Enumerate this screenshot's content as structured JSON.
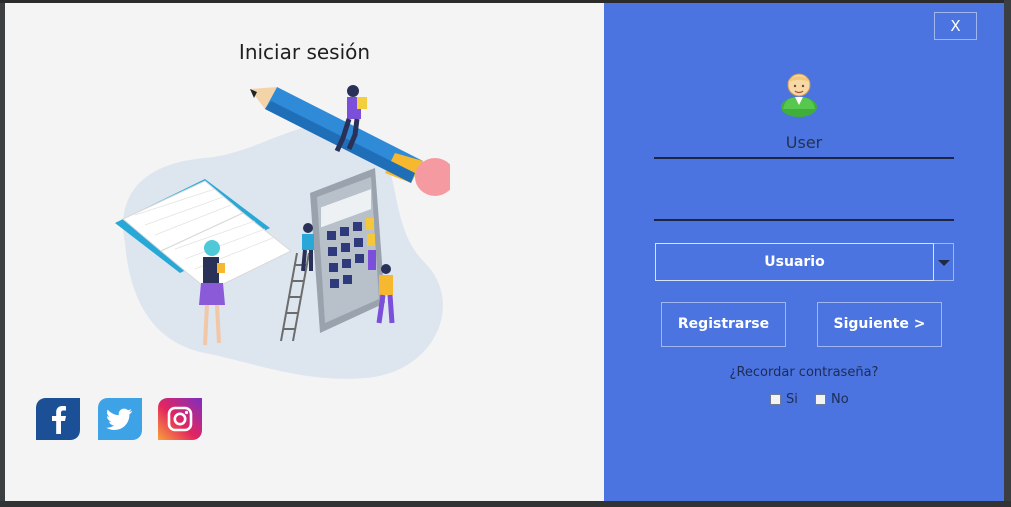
{
  "left": {
    "title": "Iniciar sesión",
    "social": [
      {
        "name": "facebook-icon",
        "color": "#1b4f96"
      },
      {
        "name": "twitter-icon",
        "color": "#3ea3e6"
      },
      {
        "name": "instagram-icon",
        "color": "#d6246e"
      }
    ]
  },
  "right": {
    "close_label": "X",
    "user_value": "User",
    "password_value": "",
    "role_selected": "Usuario",
    "register_label": "Registrarse",
    "next_label": "Siguiente >",
    "remember_label": "¿Recordar contraseña?",
    "options": {
      "yes": "Si",
      "no": "No"
    }
  },
  "colors": {
    "left_bg": "#f4f4f4",
    "right_bg": "#4b74e0",
    "text_dark": "#1e2c55"
  }
}
